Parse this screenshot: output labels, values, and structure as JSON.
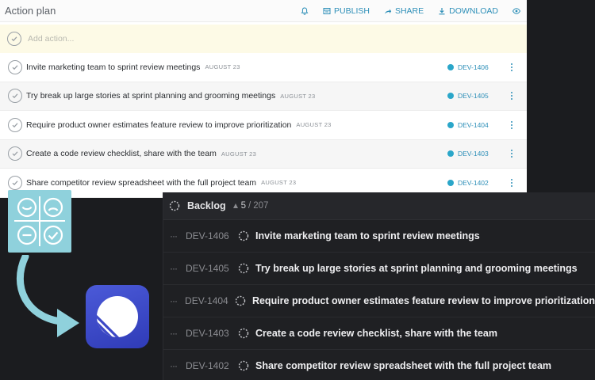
{
  "action_plan": {
    "title": "Action plan",
    "actions": {
      "publish": "PUBLISH",
      "share": "SHARE",
      "download": "DOWNLOAD"
    },
    "add_placeholder": "Add action...",
    "items": [
      {
        "text": "Invite marketing team to sprint review meetings",
        "date": "AUGUST 23",
        "issue": "DEV-1406"
      },
      {
        "text": "Try break up large stories at sprint planning and grooming meetings",
        "date": "AUGUST 23",
        "issue": "DEV-1405"
      },
      {
        "text": "Require product owner estimates feature review to improve prioritization",
        "date": "AUGUST 23",
        "issue": "DEV-1404"
      },
      {
        "text": "Create a code review checklist, share with the team",
        "date": "AUGUST 23",
        "issue": "DEV-1403"
      },
      {
        "text": "Share competitor review spreadsheet with the full project team",
        "date": "AUGUST 23",
        "issue": "DEV-1402"
      }
    ]
  },
  "backlog": {
    "title": "Backlog",
    "count_current": "5",
    "count_sep": "/",
    "count_total": "207",
    "rows": [
      {
        "dots": "···",
        "id": "DEV-1406",
        "title": "Invite marketing team to sprint review meetings"
      },
      {
        "dots": "···",
        "id": "DEV-1405",
        "title": "Try break up large stories at sprint planning and grooming meetings"
      },
      {
        "dots": "···",
        "id": "DEV-1404",
        "title": "Require product owner estimates feature review to improve prioritization"
      },
      {
        "dots": "···",
        "id": "DEV-1403",
        "title": "Create a code review checklist, share with the team"
      },
      {
        "dots": "···",
        "id": "DEV-1402",
        "title": "Share competitor review spreadsheet with the full project team"
      }
    ]
  },
  "colors": {
    "accent_blue": "#2d8fb8",
    "retro_tile": "#8fd1dc",
    "linear_brand": "#3c48c6",
    "dark_bg": "#1f2023"
  },
  "icons": [
    "bell-icon",
    "publish-icon",
    "share-icon",
    "download-icon",
    "eye-icon",
    "check-circle-icon",
    "linear-issue-icon",
    "kebab-menu-icon",
    "backlog-status-icon",
    "retrospective-icon",
    "curved-arrow-icon",
    "linear-logo-icon"
  ]
}
